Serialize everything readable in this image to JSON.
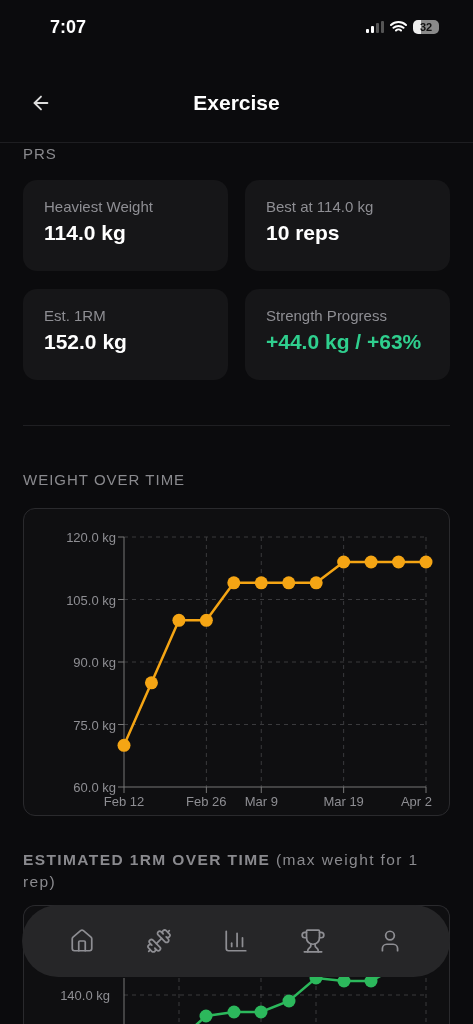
{
  "status_bar": {
    "time": "7:07",
    "battery": "32"
  },
  "header": {
    "title": "Exercise"
  },
  "prs": {
    "title": "PRS",
    "cards": [
      {
        "label": "Heaviest Weight",
        "value": "114.0 kg",
        "kind": "plain"
      },
      {
        "label": "Best at 114.0 kg",
        "value": "10 reps",
        "kind": "plain"
      },
      {
        "label": "Est. 1RM",
        "value": "152.0 kg",
        "kind": "plain"
      },
      {
        "label": "Strength Progress",
        "value": "+44.0 kg / +63%",
        "kind": "positive"
      }
    ]
  },
  "weight_section": {
    "title": "WEIGHT OVER TIME",
    "chart_data": {
      "type": "line",
      "categories": [
        "Feb 12",
        null,
        null,
        "Feb 26",
        null,
        "Mar 9",
        null,
        null,
        "Mar 19",
        null,
        null,
        "Apr 2"
      ],
      "grid": true,
      "series": [
        {
          "color": "#f5a514",
          "marker": "circle",
          "values": [
            70,
            85,
            100,
            100,
            109,
            109,
            109,
            109,
            114,
            114,
            114,
            114
          ]
        }
      ],
      "ylim": [
        60,
        120
      ],
      "yticks": [
        {
          "value": 60,
          "label": "60.0 kg"
        },
        {
          "value": 75,
          "label": "75.0 kg"
        },
        {
          "value": 90,
          "label": "90.0 kg"
        },
        {
          "value": 105,
          "label": "105.0 kg"
        },
        {
          "value": 120,
          "label": "120.0 kg"
        }
      ]
    }
  },
  "one_rm_section": {
    "title": "**ESTIMATED 1RM OVER TIME** (max weight for 1 rep)",
    "y_tick_label": "140.0 kg"
  },
  "nav": {
    "items": [
      {
        "kind": "home"
      },
      {
        "kind": "workouts"
      },
      {
        "kind": "stats"
      },
      {
        "kind": "trophies"
      },
      {
        "kind": "profile"
      }
    ]
  }
}
